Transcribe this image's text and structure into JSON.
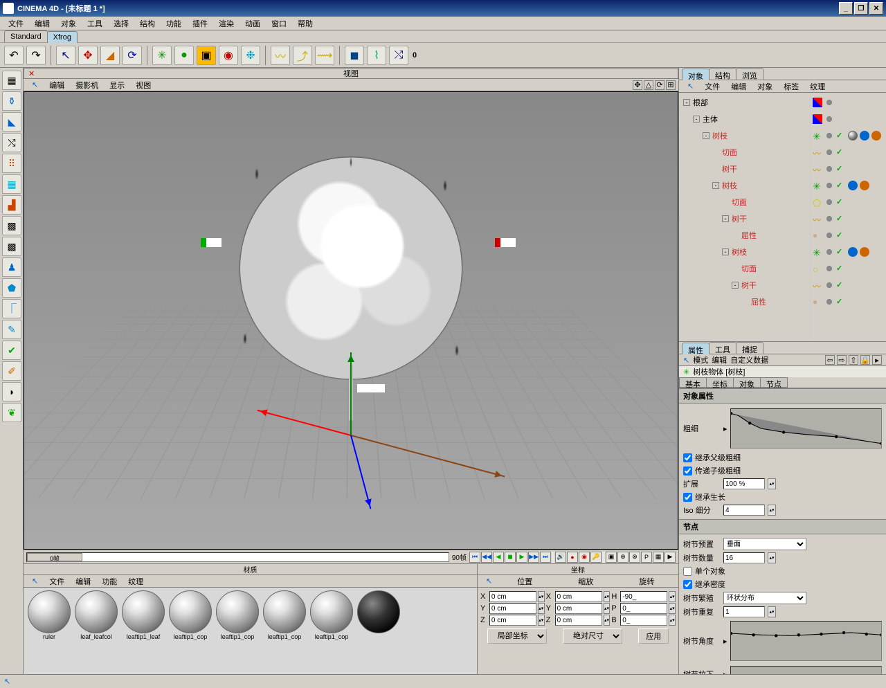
{
  "title": "CINEMA 4D - [未标题 1 *]",
  "menubar": [
    "文件",
    "编辑",
    "对象",
    "工具",
    "选择",
    "结构",
    "功能",
    "插件",
    "渲染",
    "动画",
    "窗口",
    "帮助"
  ],
  "layout_tabs": [
    {
      "label": "Standard",
      "active": false
    },
    {
      "label": "Xfrog",
      "active": true
    }
  ],
  "toolbar_zero": "0",
  "viewport": {
    "title": "视图",
    "menu": [
      "编辑",
      "摄影机",
      "显示",
      "视图"
    ]
  },
  "timeline": {
    "start": "0帧",
    "end": "90帧"
  },
  "materials": {
    "title": "材质",
    "menu": [
      "文件",
      "编辑",
      "功能",
      "纹理"
    ],
    "items": [
      "ruler",
      "leaf_leafcol",
      "leaftip1_leaf",
      "leaftip1_cop",
      "leaftip1_cop",
      "leaftip1_cop",
      "leaftip1_cop",
      ""
    ]
  },
  "coords": {
    "title": "坐标",
    "hdr": [
      "位置",
      "缩放",
      "旋转"
    ],
    "x": {
      "pos": "0 cm",
      "scale": "0 cm",
      "rot": "-90_"
    },
    "y": {
      "pos": "0 cm",
      "scale": "0 cm",
      "rot": "0_"
    },
    "z": {
      "pos": "0 cm",
      "scale": "0 cm",
      "rot": "0_"
    },
    "local": "局部坐标",
    "abs": "绝对尺寸",
    "apply": "应用"
  },
  "right_tabs": [
    "对象",
    "结构",
    "浏览"
  ],
  "obj_menu": [
    "文件",
    "编辑",
    "对象",
    "标签",
    "纹理"
  ],
  "obj_tree": [
    {
      "depth": 0,
      "exp": "-",
      "name": "根部",
      "red": false,
      "icons": [
        "xyz",
        "dots"
      ]
    },
    {
      "depth": 1,
      "exp": "-",
      "name": "主体",
      "red": false,
      "icons": [
        "xyz",
        "dots"
      ]
    },
    {
      "depth": 2,
      "exp": "-",
      "name": "树枝",
      "red": true,
      "icons": [
        "branch",
        "dots",
        "check",
        "sphere",
        "c1",
        "c2"
      ]
    },
    {
      "depth": 3,
      "exp": "",
      "name": "切面",
      "red": true,
      "icons": [
        "curve",
        "dots",
        "check"
      ]
    },
    {
      "depth": 3,
      "exp": "",
      "name": "树干",
      "red": true,
      "icons": [
        "curve",
        "dots",
        "check"
      ]
    },
    {
      "depth": 3,
      "exp": "-",
      "name": "树枝",
      "red": true,
      "icons": [
        "branch",
        "dots",
        "check",
        "c1",
        "c2"
      ]
    },
    {
      "depth": 4,
      "exp": "",
      "name": "切面",
      "red": true,
      "icons": [
        "penta",
        "dots",
        "check"
      ]
    },
    {
      "depth": 4,
      "exp": "-",
      "name": "树干",
      "red": true,
      "icons": [
        "curve",
        "dots",
        "check"
      ]
    },
    {
      "depth": 5,
      "exp": "",
      "name": "屈性",
      "red": true,
      "icons": [
        "ball",
        "dots",
        "check"
      ]
    },
    {
      "depth": 4,
      "exp": "-",
      "name": "树枝",
      "red": true,
      "icons": [
        "branch",
        "dots",
        "check",
        "c1",
        "c2"
      ]
    },
    {
      "depth": 5,
      "exp": "",
      "name": "切面",
      "red": true,
      "icons": [
        "circ",
        "dots",
        "check"
      ]
    },
    {
      "depth": 5,
      "exp": "-",
      "name": "树干",
      "red": true,
      "icons": [
        "curve",
        "dots",
        "check"
      ]
    },
    {
      "depth": 6,
      "exp": "",
      "name": "屈性",
      "red": true,
      "icons": [
        "ball",
        "dots",
        "check"
      ]
    }
  ],
  "attr_tabs": [
    "属性",
    "工具",
    "捕捉"
  ],
  "attr_menu": [
    "模式",
    "编辑",
    "自定义数据"
  ],
  "attr_title": "树枝物体 [树枝]",
  "attr_subtabs": [
    "基本",
    "坐标",
    "对象",
    "节点"
  ],
  "attr": {
    "sec1": "对象属性",
    "thickness": "粗细",
    "inherit_thick": "继承父级粗细",
    "pass_thick": "传递子级粗细",
    "expand": "扩展",
    "expand_val": "100 %",
    "inherit_growth": "继承生长",
    "iso_sub": "Iso 细分",
    "iso_val": "4",
    "sec2": "节点",
    "node_preset": "树节预置",
    "preset_val": "垂面",
    "node_count": "树节数量",
    "count_val": "16",
    "single_obj": "单个对象",
    "inherit_density": "继承密度",
    "node_prop": "树节繁殖",
    "prop_val": "环状分布",
    "node_repeat": "树节重复",
    "repeat_val": "1",
    "node_angle": "树节角度",
    "node_pull": "树节拉下"
  }
}
